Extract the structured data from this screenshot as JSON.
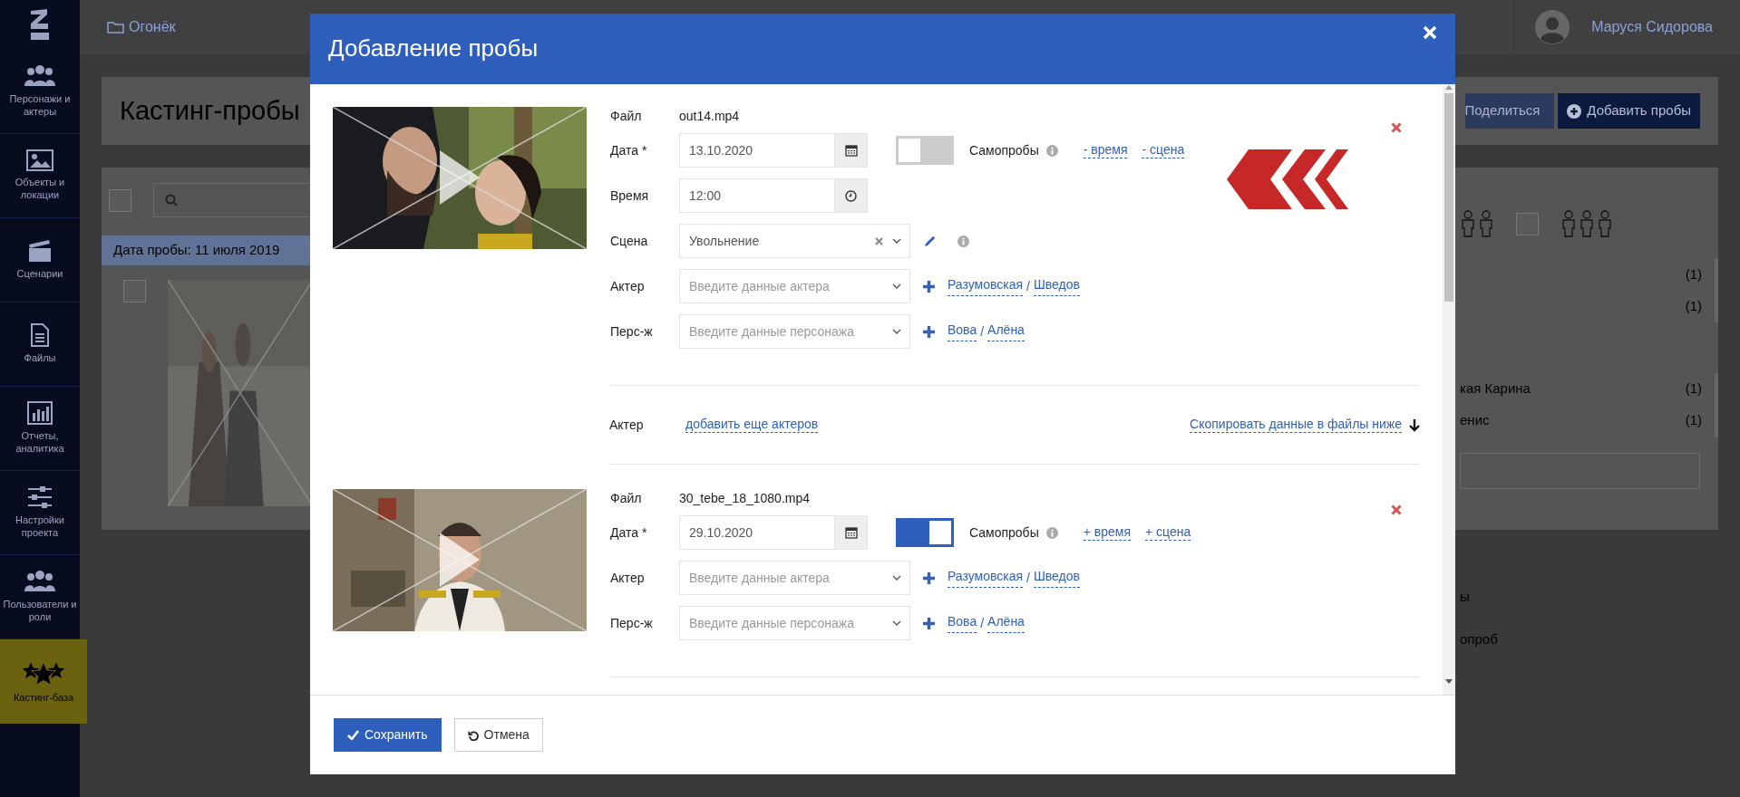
{
  "sidebar": {
    "items": [
      {
        "label": "Персонажи и актеры",
        "selected": false
      },
      {
        "label": "Объекты и локации",
        "selected": false
      },
      {
        "label": "Сценарии",
        "selected": false
      },
      {
        "label": "Файлы",
        "selected": false
      },
      {
        "label": "Отчеты, аналитика",
        "selected": false
      },
      {
        "label": "Настройки проекта",
        "selected": false
      },
      {
        "label": "Пользователи и роли",
        "selected": false
      },
      {
        "label": "Кастинг-база",
        "selected": true
      }
    ]
  },
  "topbar": {
    "breadcrumb": "Огонёк",
    "user_name": "Маруся Сидорова"
  },
  "page": {
    "title": "Кастинг-пробы",
    "buttons": [
      {
        "kind": "share",
        "label": "Поделиться"
      },
      {
        "kind": "add",
        "label": "Добавить пробы"
      }
    ],
    "select_all": {
      "checked": false
    },
    "date_group": "Дата пробы: 11 июля 2019",
    "trials": [
      {
        "checked": false
      }
    ],
    "filter": {
      "checked": false
    },
    "lists": [
      {
        "items": [
          {
            "count": "(1)"
          },
          {
            "count": "(1)"
          }
        ]
      },
      {
        "items": [
          {
            "name": "кая Карина",
            "count": "(1)"
          },
          {
            "name": "енис",
            "count": "(1)"
          }
        ]
      }
    ],
    "notes": [
      "ы",
      "опроб"
    ]
  },
  "modal": {
    "title": "Добавление пробы",
    "files": [
      {
        "file_label": "Файл",
        "file_name": "out14.mp4",
        "flagged": true,
        "self_test": {
          "label": "Самопробы",
          "on": false
        },
        "self_test_links": [
          "- время",
          "- сцена"
        ],
        "fields": [
          {
            "kind": "date",
            "label": "Дата *",
            "value": "13.10.2020"
          },
          {
            "kind": "time",
            "label": "Время",
            "value": "12:00"
          },
          {
            "kind": "scene",
            "label": "Сцена",
            "value": "Увольнение"
          },
          {
            "kind": "person",
            "label": "Актер",
            "placeholder": "Введите данные актера",
            "suggestions": [
              "Разумовская",
              "Шведов"
            ],
            "separator": "/"
          },
          {
            "kind": "person",
            "label": "Перс-ж",
            "placeholder": "Введите данные персонажа",
            "suggestions": [
              "Вова",
              "Алёна"
            ],
            "separator": "/"
          }
        ]
      },
      {
        "file_label": "Файл",
        "file_name": "30_tebe_18_1080.mp4",
        "flagged": false,
        "self_test": {
          "label": "Самопробы",
          "on": true
        },
        "self_test_links": [
          "+ время",
          "+ сцена"
        ],
        "fields": [
          {
            "kind": "date",
            "label": "Дата *",
            "value": "29.10.2020"
          },
          {
            "kind": "person",
            "label": "Актер",
            "placeholder": "Введите данные актера",
            "suggestions": [
              "Разумовская",
              "Шведов"
            ],
            "separator": "/"
          },
          {
            "kind": "person",
            "label": "Перс-ж",
            "placeholder": "Введите данные персонажа",
            "suggestions": [
              "Вова",
              "Алёна"
            ],
            "separator": "/"
          }
        ]
      }
    ],
    "actors_row": {
      "label": "Актер",
      "add_link": "добавить еще актеров",
      "copy_link": "Скопировать данные в файлы ниже"
    },
    "buttons": [
      {
        "kind": "save",
        "label": "Сохранить"
      },
      {
        "kind": "cancel",
        "label": "Отмена"
      }
    ]
  }
}
